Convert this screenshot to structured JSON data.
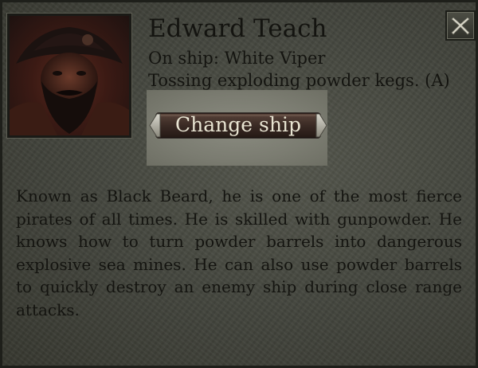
{
  "character": {
    "name": "Edward Teach",
    "ship_line": "On ship: White Viper",
    "ability_line": "Tossing exploding powder kegs. (A)"
  },
  "actions": {
    "change_ship_label": "Change ship"
  },
  "description": "Known as Black Beard, he is one of the most fierce pirates of all times. He is skilled with gunpowder. He knows how to turn powder barrels into dangerous explosive sea mines. He can also use powder barrels to quickly destroy an enemy ship during close range attacks.",
  "icons": {
    "close": "close-x-icon",
    "portrait": "pirate-portrait"
  },
  "colors": {
    "panel": "#45473f",
    "text": "#141410",
    "button_text": "#e8e4d2",
    "button_fill": "#3a2a24"
  }
}
